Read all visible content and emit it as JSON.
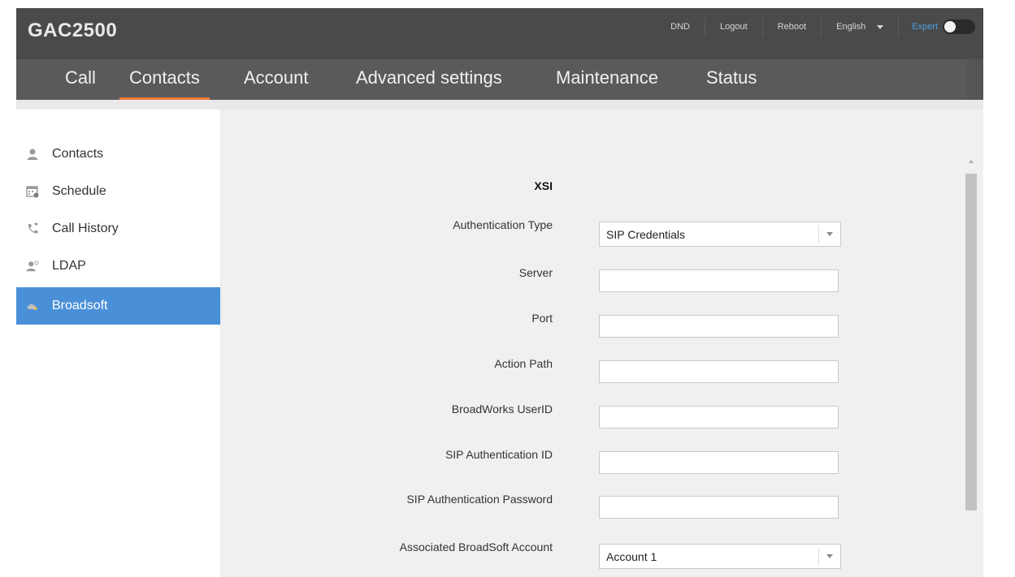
{
  "app": {
    "title": "GAC2500"
  },
  "toplinks": {
    "dnd": "DND",
    "logout": "Logout",
    "reboot": "Reboot",
    "language": "English",
    "expert": "Expert"
  },
  "nav": {
    "tabs": [
      {
        "label": "Call"
      },
      {
        "label": "Contacts",
        "active": true
      },
      {
        "label": "Account"
      },
      {
        "label": "Advanced settings"
      },
      {
        "label": "Maintenance"
      },
      {
        "label": "Status"
      }
    ]
  },
  "sidebar": {
    "items": [
      {
        "label": "Contacts",
        "icon": "person-icon"
      },
      {
        "label": "Schedule",
        "icon": "calendar-icon"
      },
      {
        "label": "Call History",
        "icon": "phone-history-icon"
      },
      {
        "label": "LDAP",
        "icon": "ldap-user-icon"
      },
      {
        "label": "Broadsoft",
        "icon": "cloud-icon",
        "active": true
      }
    ]
  },
  "form": {
    "section": "XSI",
    "fields": [
      {
        "label": "Authentication Type",
        "type": "select",
        "value": "SIP Credentials"
      },
      {
        "label": "Server",
        "type": "text",
        "value": ""
      },
      {
        "label": "Port",
        "type": "text",
        "value": ""
      },
      {
        "label": "Action Path",
        "type": "text",
        "value": ""
      },
      {
        "label": "BroadWorks UserID",
        "type": "text",
        "value": ""
      },
      {
        "label": "SIP Authentication ID",
        "type": "text",
        "value": ""
      },
      {
        "label": "SIP Authentication Password",
        "type": "text",
        "value": ""
      },
      {
        "label": "Associated BroadSoft Account",
        "type": "select",
        "value": "Account 1"
      }
    ]
  },
  "colors": {
    "accent": "#4a90d9",
    "tab_underline": "#f07a3a",
    "header_bg": "#4a4a4a"
  }
}
